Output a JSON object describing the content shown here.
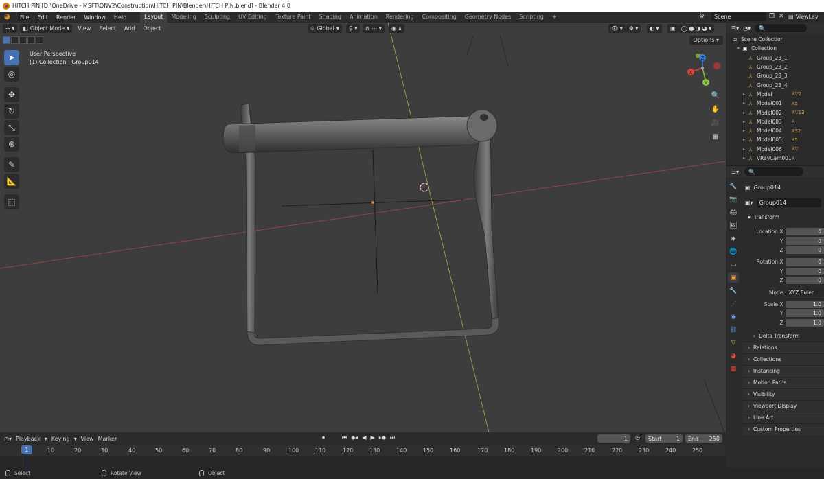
{
  "window": {
    "title": "HITCH PIN [D:\\OneDrive - MSFT\\ONV2\\Construction\\HITCH PIN\\Blender\\HITCH PIN.blend] - Blender 4.0"
  },
  "menu": [
    "File",
    "Edit",
    "Render",
    "Window",
    "Help"
  ],
  "workspaces": [
    "Layout",
    "Modeling",
    "Sculpting",
    "UV Editing",
    "Texture Paint",
    "Shading",
    "Animation",
    "Rendering",
    "Compositing",
    "Geometry Nodes",
    "Scripting"
  ],
  "active_workspace": "Layout",
  "scene": {
    "name": "Scene",
    "view_layer": "ViewLay"
  },
  "viewport": {
    "mode": "Object Mode",
    "menus": [
      "View",
      "Select",
      "Add",
      "Object"
    ],
    "orientation": "Global",
    "options_label": "Options",
    "info_line1": "User Perspective",
    "info_line2": "(1) Collection | Group014",
    "gizmo": {
      "x": "X",
      "y": "Y",
      "z": "Z"
    }
  },
  "outliner": {
    "root": "Scene Collection",
    "collection": "Collection",
    "items": [
      {
        "name": "Group_23_1",
        "extra": ""
      },
      {
        "name": "Group_23_2",
        "extra": ""
      },
      {
        "name": "Group_23_3",
        "extra": ""
      },
      {
        "name": "Group_23_4",
        "extra": ""
      },
      {
        "name": "Model",
        "extra": "2"
      },
      {
        "name": "Model001",
        "extra": "5"
      },
      {
        "name": "Model002",
        "extra": "13"
      },
      {
        "name": "Model003",
        "extra": ""
      },
      {
        "name": "Model004",
        "extra": "32"
      },
      {
        "name": "Model005",
        "extra": "5"
      },
      {
        "name": "Model006",
        "extra": ""
      },
      {
        "name": "VRayCam001",
        "extra": ""
      }
    ]
  },
  "properties": {
    "object_name": "Group014",
    "data_name": "Group014",
    "transform_label": "Transform",
    "location_label": "Location X",
    "rotation_label": "Rotation X",
    "scale_label": "Scale X",
    "y_label": "Y",
    "z_label": "Z",
    "location": [
      "0",
      "0",
      "0"
    ],
    "rotation": [
      "0",
      "0",
      "0"
    ],
    "scale": [
      "1.0",
      "1.0",
      "1.0"
    ],
    "mode_label": "Mode",
    "mode_value": "XYZ Euler",
    "delta": "Delta Transform",
    "panels": [
      "Relations",
      "Collections",
      "Instancing",
      "Motion Paths",
      "Visibility",
      "Viewport Display",
      "Line Art",
      "Custom Properties"
    ]
  },
  "timeline": {
    "menus": [
      "Playback",
      "Keying",
      "View",
      "Marker"
    ],
    "current_frame": "1",
    "start_label": "Start",
    "start": "1",
    "end_label": "End",
    "end": "250",
    "ruler": [
      "10",
      "20",
      "30",
      "40",
      "50",
      "60",
      "70",
      "80",
      "90",
      "100",
      "110",
      "120",
      "130",
      "140",
      "150",
      "160",
      "170",
      "180",
      "190",
      "200",
      "210",
      "220",
      "230",
      "240",
      "250"
    ],
    "ruler_current": "1"
  },
  "status": [
    "Select",
    "Rotate View",
    "Object"
  ],
  "colors": {
    "accent": "#4772b3",
    "x_axis": "#e0453b",
    "y_axis": "#8bc53f",
    "z_axis": "#3b82e0",
    "object_orange": "#d89b4b"
  }
}
